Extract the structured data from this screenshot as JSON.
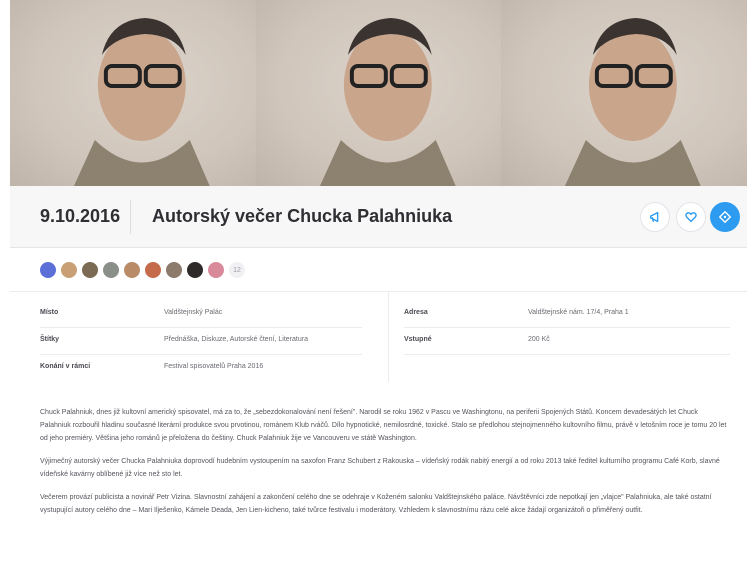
{
  "event": {
    "date": "9.10.2016",
    "title": "Autorský večer Chucka Palahniuka"
  },
  "actions": [
    {
      "name": "share-button",
      "icon": "megaphone-icon"
    },
    {
      "name": "favorite-button",
      "icon": "heart-icon"
    },
    {
      "name": "ticket-button",
      "icon": "ticket-icon"
    }
  ],
  "attendees": {
    "avatar_colors": [
      "#5b6fd6",
      "#c9a076",
      "#7b6b55",
      "#8a8f8a",
      "#b98b66",
      "#c56a4a",
      "#8c7a6a",
      "#2f2a2a",
      "#d98a9a"
    ],
    "more_count": "12"
  },
  "info": {
    "left": [
      {
        "label": "Místo",
        "value": "Valdštejnský Palác"
      },
      {
        "label": "Štítky",
        "value": "Přednáška, Diskuze, Autorské čtení, Literatura"
      },
      {
        "label": "Konání v rámci",
        "value": "Festival spisovatelů Praha 2016"
      }
    ],
    "right": [
      {
        "label": "Adresa",
        "value": "Valdštejnské nám. 17/4, Praha 1"
      },
      {
        "label": "Vstupné",
        "value": "200 Kč"
      },
      {
        "label": "",
        "value": ""
      }
    ]
  },
  "description": [
    "Chuck Palahniuk, dnes již kultovní americký spisovatel, má za to, že „sebezdokonalování není řešení\". Narodil se roku 1962 v Pascu ve Washingtonu, na periferii Spojených Států. Koncem devadesátých let Chuck Palahniuk rozbouřil hladinu současné literární produkce svou prvotinou, románem Klub rváčů. Dílo hypnotické, nemilosrdné, toxické. Stalo se předlohou stejnojmenného kultovního filmu, právě v letošním roce je tomu 20 let od jeho premiéry. Většina jeho románů je přeložena do češtiny. Chuck Palahniuk žije ve Vancouveru ve státě Washington.",
    "Výjimečný autorský večer Chucka Palahniuka doprovodí hudebním vystoupením na saxofon Franz Schubert z Rakouska – vídeňský rodák nabitý energií a od roku 2013 také ředitel kulturního programu Café Korb, slavné vídeňské kavárny oblíbené již více než sto let.",
    "Večerem provází publicista a novinář Petr Vizina. Slavnostní zahájení a zakončení celého dne se odehraje v Koženém salonku Valdštejnského paláce. Návštěvníci zde nepotkají jen „vlajce\" Palahniuka, ale také ostatní vystupující autory celého dne – Mari Ilješenko, Kámele Deada, Jen Lien-kicheno, také tvůrce festivalu i moderátory. Vzhledem k slavnostnímu rázu celé akce žádají organizátoři o přiměřený outfit."
  ]
}
